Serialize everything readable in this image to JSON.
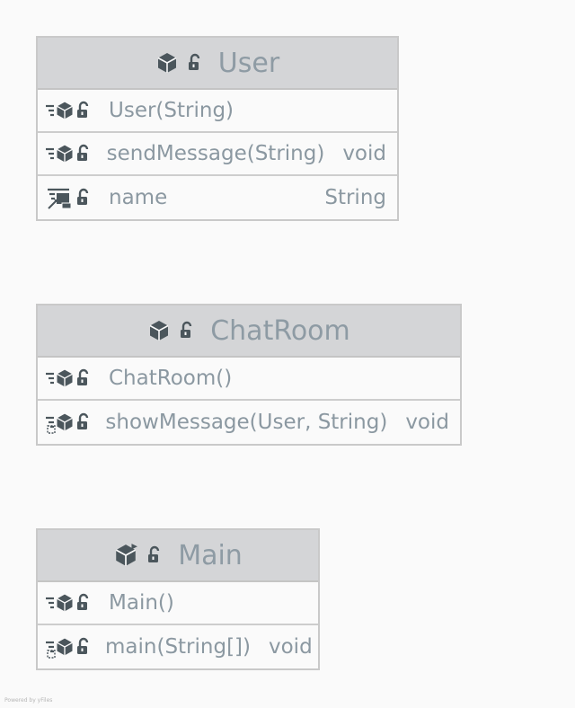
{
  "classes": [
    {
      "name": "User",
      "members": [
        {
          "label": "User(String)",
          "type": "",
          "kind": "method"
        },
        {
          "label": "sendMessage(String)",
          "type": "void",
          "kind": "method"
        },
        {
          "label": "name",
          "type": "String",
          "kind": "field"
        }
      ]
    },
    {
      "name": "ChatRoom",
      "members": [
        {
          "label": "ChatRoom()",
          "type": "",
          "kind": "method"
        },
        {
          "label": "showMessage(User, String)",
          "type": "void",
          "kind": "static-method"
        }
      ]
    },
    {
      "name": "Main",
      "members": [
        {
          "label": "Main()",
          "type": "",
          "kind": "method"
        },
        {
          "label": "main(String[])",
          "type": "void",
          "kind": "static-method"
        }
      ]
    }
  ],
  "footer": "Powered by yFiles",
  "colors": {
    "header": "#d4d5d7",
    "text": "#8b98a1",
    "icon": "#4b565c",
    "border": "#c9c9c9"
  }
}
